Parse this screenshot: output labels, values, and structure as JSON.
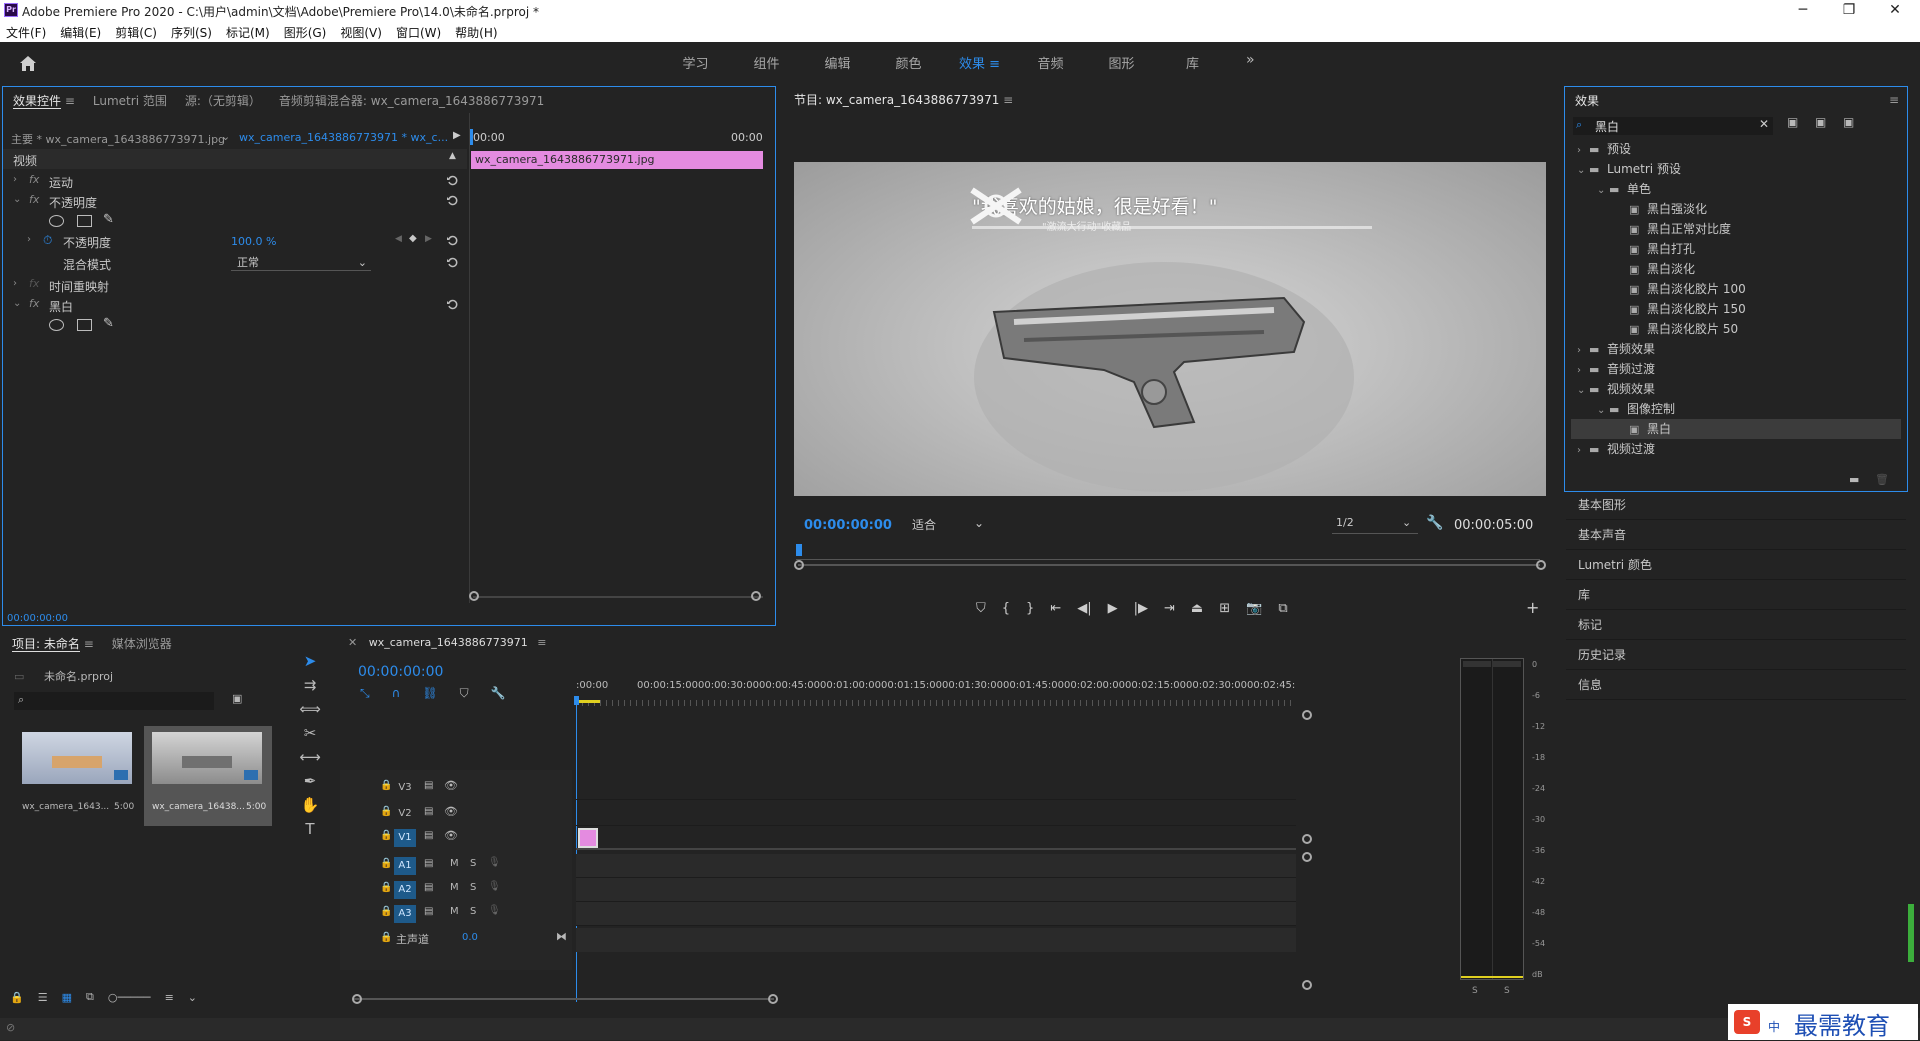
{
  "app": {
    "title": "Adobe Premiere Pro 2020 - C:\\用户\\admin\\文档\\Adobe\\Premiere Pro\\14.0\\未命名.prproj *",
    "logo": "Pr"
  },
  "window_controls": [
    "─",
    "❐",
    "✕"
  ],
  "menu": [
    "文件(F)",
    "编辑(E)",
    "剪辑(C)",
    "序列(S)",
    "标记(M)",
    "图形(G)",
    "视图(V)",
    "窗口(W)",
    "帮助(H)"
  ],
  "workspaces": [
    "学习",
    "组件",
    "编辑",
    "颜色",
    "效果",
    "音频",
    "图形",
    "库"
  ],
  "workspace_active": "效果",
  "workspace_more": "»",
  "effect_controls": {
    "tabs": [
      "效果控件",
      "Lumetri 范围",
      "源:（无剪辑）",
      "音频剪辑混合器: wx_camera_1643886773971"
    ],
    "master_clip": "主要 * wx_camera_1643886773971.jpg",
    "sequence_clip": "wx_camera_1643886773971 * wx_c...",
    "time_start": "00:00",
    "time_end": "00:00",
    "clip_bar": "wx_camera_1643886773971.jpg",
    "section": "视频",
    "motion": "运动",
    "opacity": "不透明度",
    "opacity_param": "不透明度",
    "opacity_value": "100.0 %",
    "blend_label": "混合模式",
    "blend_value": "正常",
    "time_remap": "时间重映射",
    "bw": "黑白",
    "fx_symbol": "fx",
    "timecode": "00:00:00:00"
  },
  "program": {
    "title": "节目: wx_camera_1643886773971",
    "timecode": "00:00:00:00",
    "fit": "适合",
    "resolution": "1/2",
    "duration": "00:00:05:00",
    "frame_text": "\"我喜欢的姑娘，很是好看！\"",
    "frame_subtext": "\"激流大行动\"收藏品"
  },
  "effects": {
    "title": "效果",
    "search": "黑白",
    "tree": [
      {
        "label": "预设",
        "level": 0,
        "type": "folder",
        "open": false
      },
      {
        "label": "Lumetri 预设",
        "level": 0,
        "type": "folder",
        "open": true
      },
      {
        "label": "单色",
        "level": 1,
        "type": "folder",
        "open": true
      },
      {
        "label": "黑白强淡化",
        "level": 2,
        "type": "item"
      },
      {
        "label": "黑白正常对比度",
        "level": 2,
        "type": "item"
      },
      {
        "label": "黑白打孔",
        "level": 2,
        "type": "item"
      },
      {
        "label": "黑白淡化",
        "level": 2,
        "type": "item"
      },
      {
        "label": "黑白淡化胶片 100",
        "level": 2,
        "type": "item"
      },
      {
        "label": "黑白淡化胶片 150",
        "level": 2,
        "type": "item"
      },
      {
        "label": "黑白淡化胶片 50",
        "level": 2,
        "type": "item"
      },
      {
        "label": "音频效果",
        "level": 0,
        "type": "folder",
        "open": false
      },
      {
        "label": "音频过渡",
        "level": 0,
        "type": "folder",
        "open": false
      },
      {
        "label": "视频效果",
        "level": 0,
        "type": "folder",
        "open": true
      },
      {
        "label": "图像控制",
        "level": 1,
        "type": "folder",
        "open": true
      },
      {
        "label": "黑白",
        "level": 2,
        "type": "item",
        "selected": true
      },
      {
        "label": "视频过渡",
        "level": 0,
        "type": "folder",
        "open": false
      }
    ]
  },
  "side_panels": [
    "基本图形",
    "基本声音",
    "Lumetri 颜色",
    "库",
    "标记",
    "历史记录",
    "信息"
  ],
  "project": {
    "tabs": [
      "项目: 未命名",
      "媒体浏览器"
    ],
    "file": "未命名.prproj",
    "items": [
      {
        "name": "wx_camera_1643...",
        "duration": "5:00"
      },
      {
        "name": "wx_camera_16438...",
        "duration": "5:00"
      }
    ]
  },
  "timeline": {
    "tab": "wx_camera_1643886773971",
    "timecode": "00:00:00:00",
    "ruler": [
      ":00:00",
      "00:00:15:00",
      "00:00:30:00",
      "00:00:45:00",
      "00:01:00:00",
      "00:01:15:00",
      "00:01:30:00",
      "00:01:45:00",
      "00:02:00:00",
      "00:02:15:00",
      "00:02:30:00",
      "00:02:45:"
    ],
    "video_tracks": [
      "V3",
      "V2",
      "V1"
    ],
    "audio_tracks": [
      "A1",
      "A2",
      "A3"
    ],
    "mute": "M",
    "solo": "S",
    "master": "主声道",
    "master_value": "0.0"
  },
  "meter": {
    "scale": [
      "0",
      "-6",
      "-12",
      "-18",
      "-24",
      "-30",
      "-36",
      "-42",
      "-48",
      "-54",
      "dB"
    ],
    "solo": [
      "S",
      "S"
    ]
  },
  "watermark": {
    "text": "最需教育",
    "small": "中"
  },
  "colors": {
    "accent": "#2d8ceb",
    "clip": "#e48be0",
    "panel": "#232323"
  }
}
